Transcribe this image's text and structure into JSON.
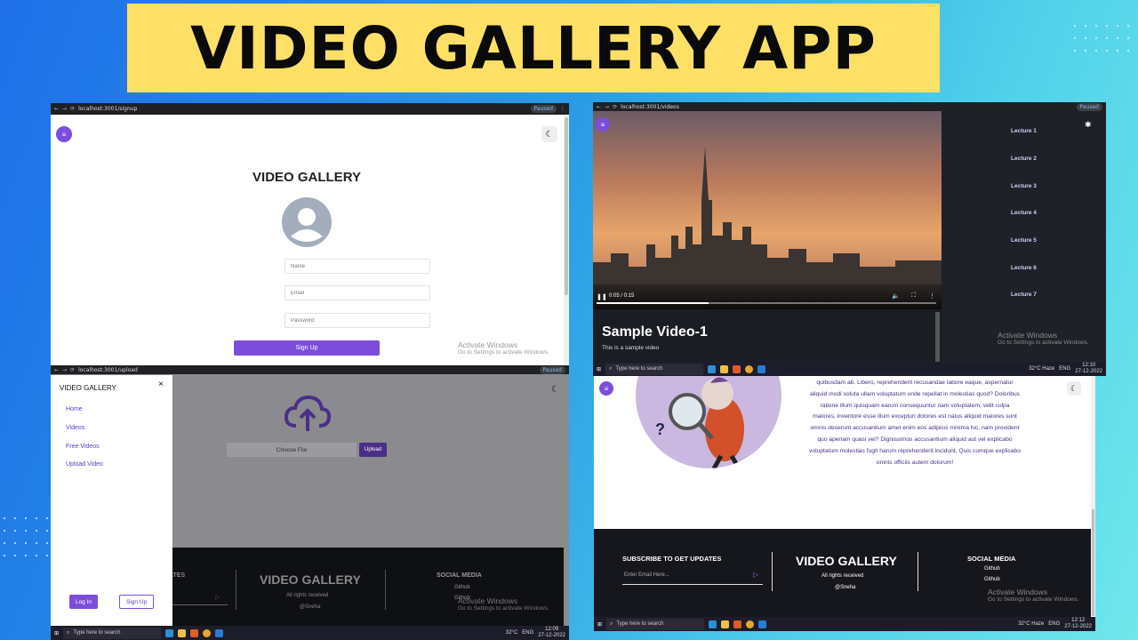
{
  "banner": {
    "title": "VIDEO GALLERY APP"
  },
  "chrome": {
    "signup_url": "localhost:3001/signup",
    "videos_url": "localhost:3001/videos",
    "upload_url": "localhost:3001/upload",
    "paused": "Paused"
  },
  "signup": {
    "title": "VIDEO GALLERY",
    "name_placeholder": "Name",
    "email_placeholder": "Email",
    "password_placeholder": "Password",
    "submit": "Sign Up"
  },
  "watermark": {
    "line1": "Activate Windows",
    "line2": "Go to Settings to activate Windows."
  },
  "videos": {
    "time": "0:05 / 0:15",
    "video_title": "Sample Video-1",
    "video_desc": "This is a sample video",
    "lectures": [
      "Lecture 1",
      "Lecture 2",
      "Lecture 3",
      "Lecture 4",
      "Lecture 5",
      "Lecture 6",
      "Lecture 7"
    ]
  },
  "taskbar": {
    "search": "Type here to search",
    "weather_a": "32°C Haze",
    "weather_b": "32°C",
    "lang": "ENG",
    "time_a": "12:10",
    "date_a": "27-12-2022",
    "time_b": "12:09",
    "date_b": "27-12-2022",
    "time_c": "12:12",
    "date_c": "27-12-2022"
  },
  "upload": {
    "menu_title": "VIDEO GALLERY",
    "links": [
      "Home",
      "Videos",
      "Free Videos",
      "Upload Video"
    ],
    "login": "Log In",
    "signup": "Sign Up",
    "choose_file": "Choose File",
    "upload_btn": "Upload",
    "footer_subscribe": "ATES",
    "footer_title": "VIDEO GALLERY",
    "footer_rights": "All rights received",
    "footer_author": "@Sneha",
    "social_title": "SOCIAL MEDIA",
    "social_links": [
      "Github",
      "Github"
    ]
  },
  "about": {
    "paragraph": "quibusdam ab. Libero, reprehenderit recusandae labore eaque, aspernatur aliquid modi soluta ullam voluptatum unde repellat in molestias quod? Doloribus ratione illum quisquam earum consequuntur nam voluptatem, velit culpa maiores, inventore esse illum excepturi dolores est natus aliquid maiores sunt omnis deserunt accusantium amet enim eos adipisci minima hic, nam provident quo aperiam quasi vel? Dignissimos accusantium aliquid aut vel explicabo voluptatum molestias fugit harum reprehenderit incidunt. Quis cumque explicabo omnis officiis autem dolorum!",
    "subscribe_title": "SUBSCRIBE TO GET UPDATES",
    "email_placeholder": "Enter Email Here...",
    "footer_title": "VIDEO GALLERY",
    "footer_rights": "All rights received",
    "footer_author": "@Sneha",
    "social_title": "SOCIAL MEDIA",
    "social_links": [
      "Github",
      "Github"
    ]
  },
  "colors": {
    "accent": "#7c4ddb",
    "banner": "#ffe066",
    "dark": "#1b1d24"
  }
}
